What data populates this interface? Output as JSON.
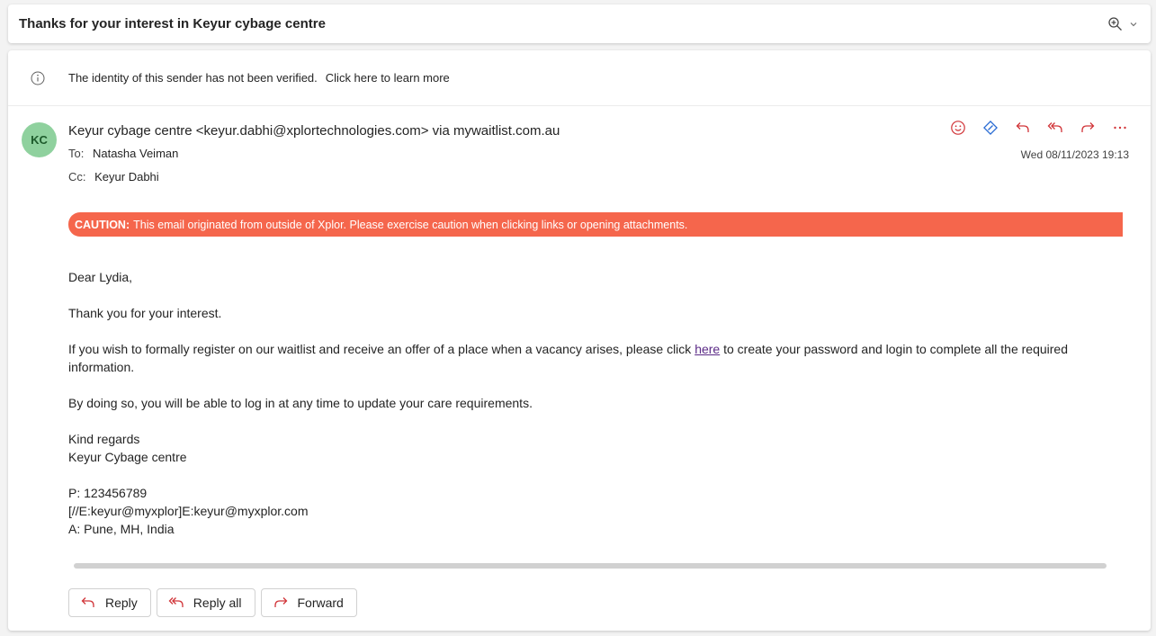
{
  "subject": "Thanks for your interest in Keyur cybage centre",
  "sender_warning": {
    "text": "The identity of this sender has not been verified.",
    "link": "Click here to learn more"
  },
  "header": {
    "avatar_initials": "KC",
    "from": "Keyur cybage centre <keyur.dabhi@xplortechnologies.com> via mywaitlist.com.au",
    "to_label": "To:",
    "to": "Natasha Veiman",
    "cc_label": "Cc:",
    "cc": "Keyur Dabhi",
    "date": "Wed 08/11/2023 19:13"
  },
  "caution": {
    "label": "CAUTION:",
    "text": "This email originated from outside of Xplor. Please exercise caution when clicking links or opening attachments."
  },
  "body": {
    "greeting": "Dear Lydia,",
    "thanks": "Thank you for your interest.",
    "register_before": "If you wish to formally register on our waitlist and receive an offer of a place when a vacancy arises, please click ",
    "register_link": "here",
    "register_after": " to create your password and login to complete all the required information.",
    "login_info": "By doing so, you will be able to log in at any time to update your care requirements.",
    "regards": "Kind regards",
    "signature_name": "Keyur Cybage centre",
    "phone": "P: 123456789",
    "email_line": "[//E:keyur@myxplor]E:keyur@myxplor.com",
    "address": "A: Pune, MH, India"
  },
  "footer": {
    "reply": "Reply",
    "reply_all": "Reply all",
    "forward": "Forward"
  },
  "colors": {
    "accent": "#d13438",
    "caution_bg": "#f5664c",
    "avatar_bg": "#8fd19e",
    "link": "#5b2a86"
  }
}
